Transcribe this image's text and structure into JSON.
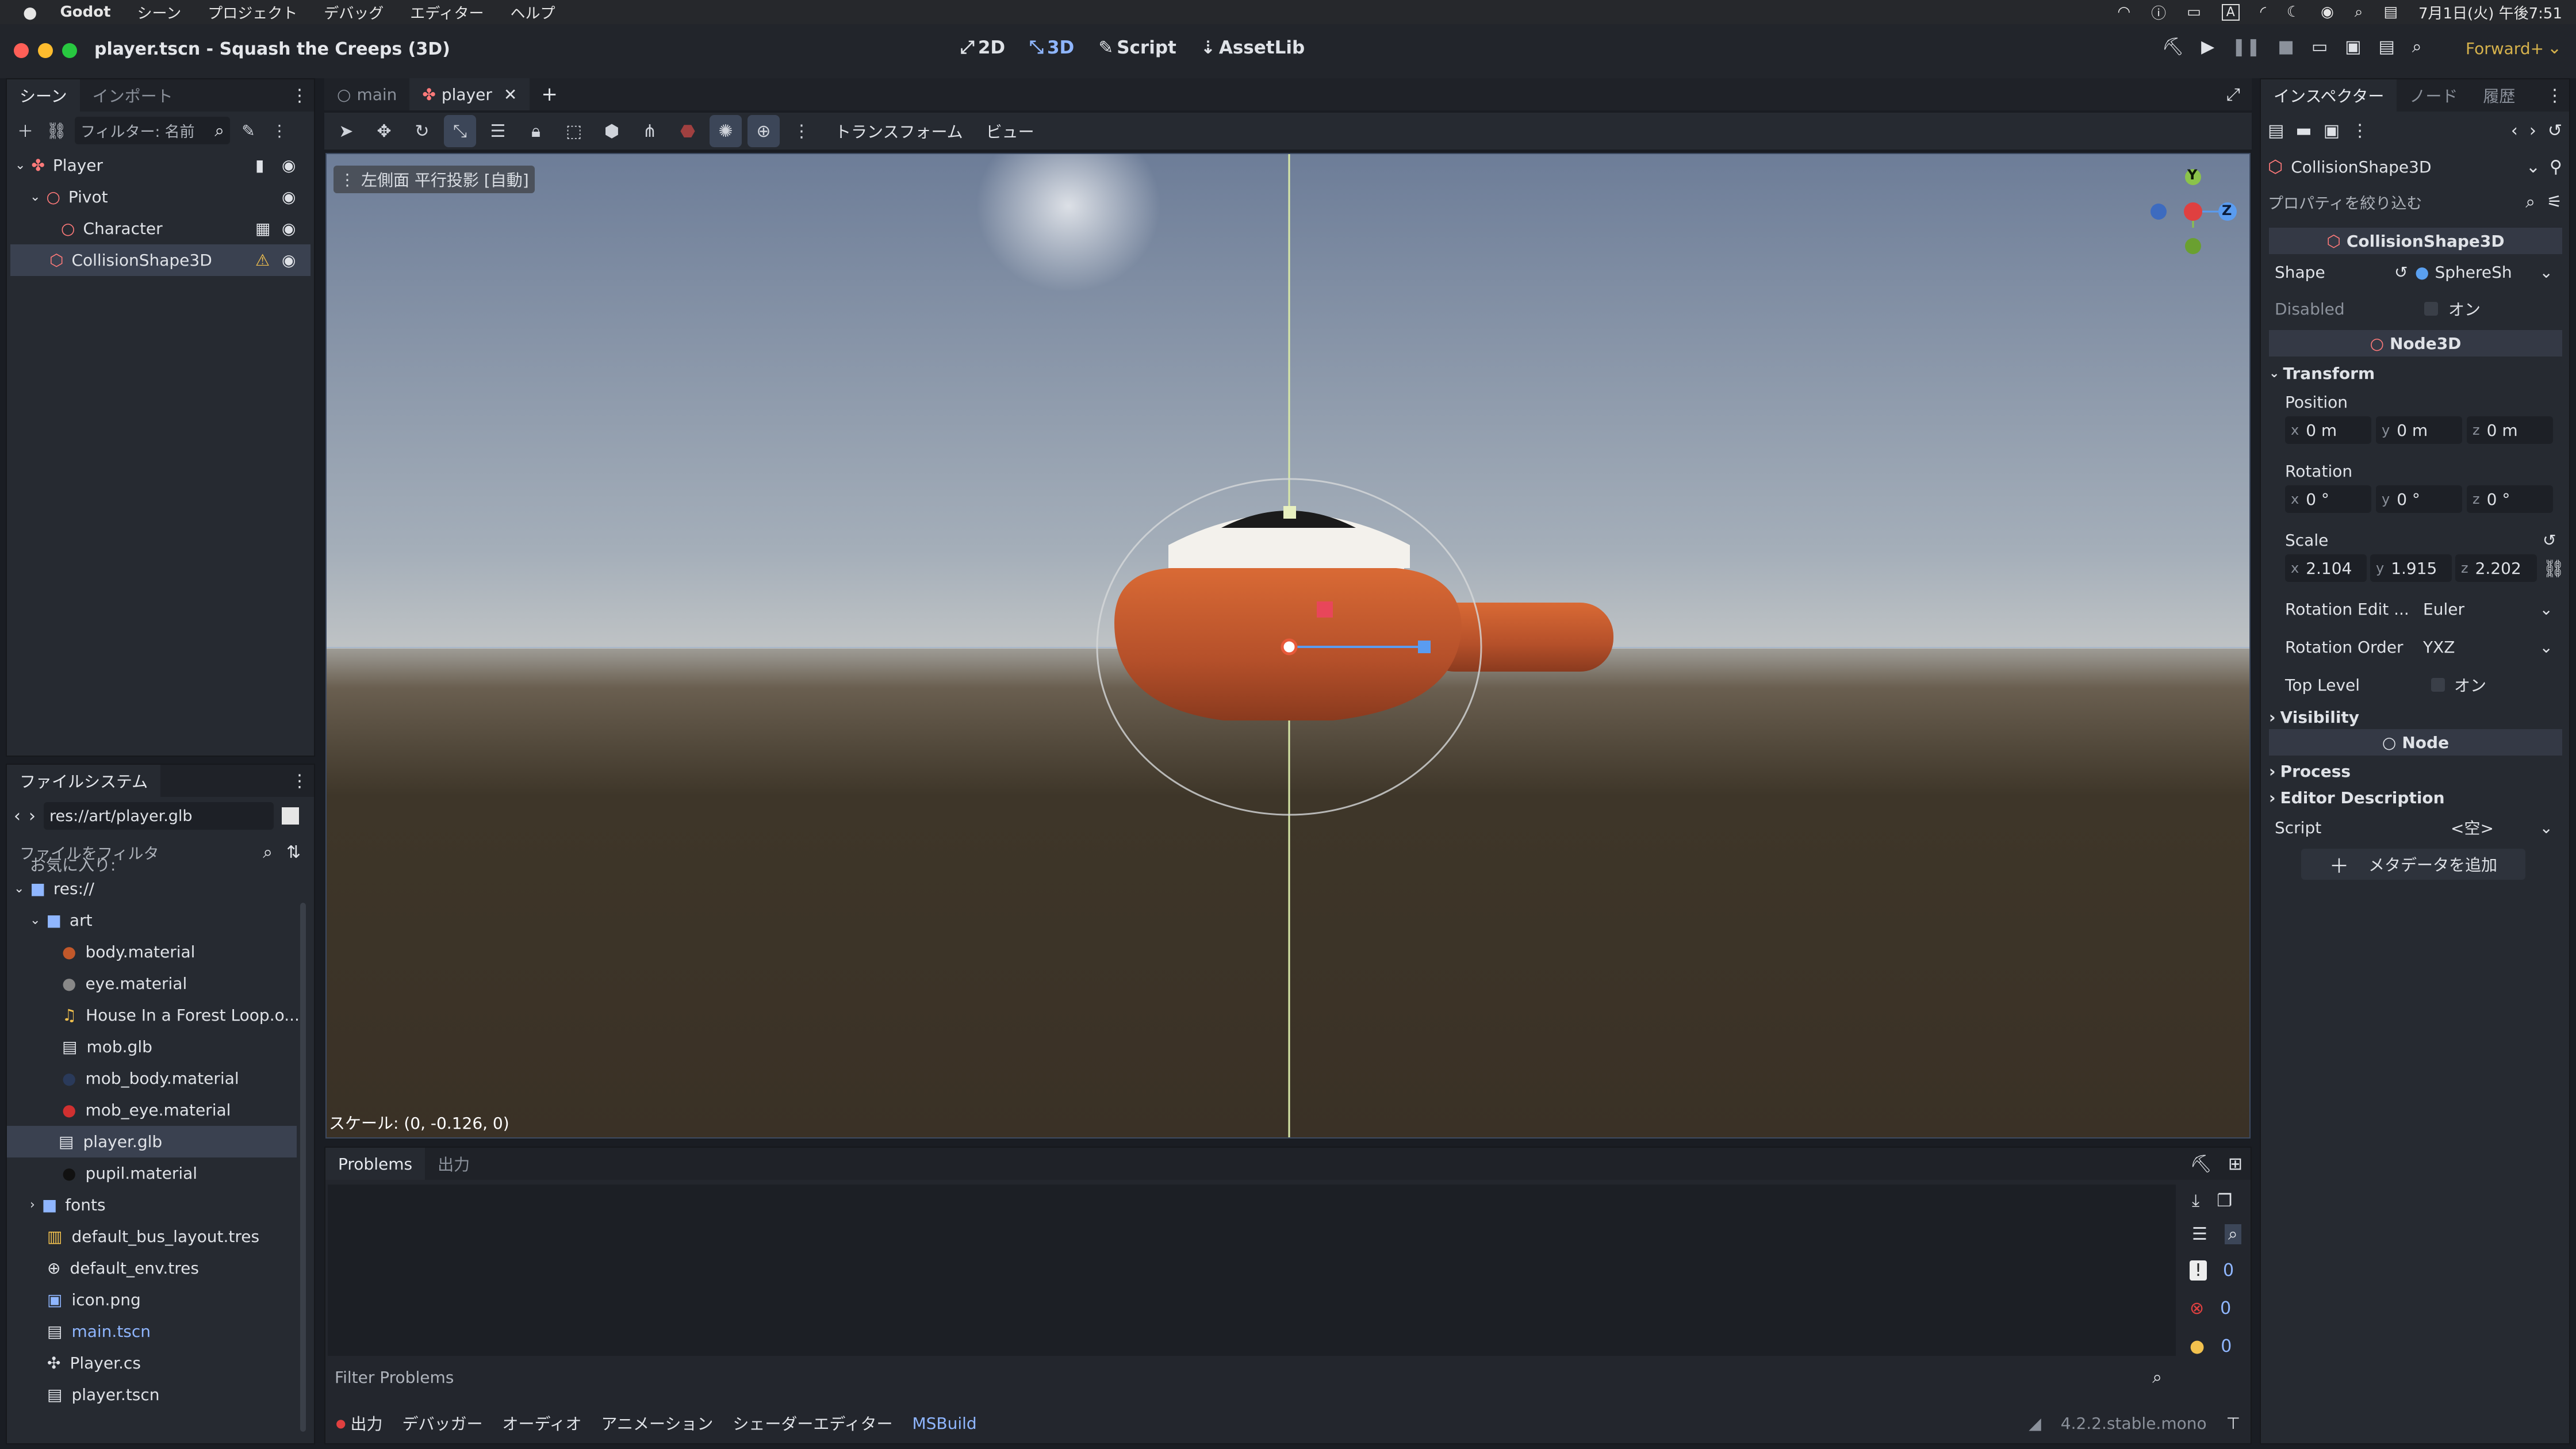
{
  "macbar": {
    "apple": "",
    "app": "Godot",
    "menus": [
      "シーン",
      "プロジェクト",
      "デバッグ",
      "エディター",
      "ヘルプ"
    ],
    "clock": "7月1日(火) 午後7:51",
    "input": "A"
  },
  "window": {
    "title": "player.tscn - Squash the Creeps (3D)",
    "modes": [
      "2D",
      "3D",
      "Script",
      "AssetLib"
    ],
    "renderer": "Forward+"
  },
  "scene_dock": {
    "tabs": [
      "シーン",
      "インポート"
    ],
    "filter_placeholder": "フィルター: 名前",
    "nodes": [
      {
        "name": "Player"
      },
      {
        "name": "Pivot"
      },
      {
        "name": "Character"
      },
      {
        "name": "CollisionShape3D"
      }
    ]
  },
  "fs_dock": {
    "tab": "ファイルシステム",
    "path": "res://art/player.glb",
    "filter_placeholder": "ファイルをフィルタ",
    "partial": "お気に入り:",
    "items": [
      "res://",
      "art",
      "body.material",
      "eye.material",
      "House In a Forest Loop.o...",
      "mob.glb",
      "mob_body.material",
      "mob_eye.material",
      "player.glb",
      "pupil.material",
      "fonts",
      "default_bus_layout.tres",
      "default_env.tres",
      "icon.png",
      "main.tscn",
      "Player.cs",
      "player.tscn"
    ]
  },
  "editor_tabs": {
    "tabs": [
      "main",
      "player"
    ],
    "add": "+"
  },
  "viewport_toolbar": {
    "transform": "トランスフォーム",
    "view": "ビュー"
  },
  "viewport": {
    "label": "左側面 平行投影 [自動]",
    "status": "スケール: (0, -0.126, 0)",
    "gizmo": {
      "y": "Y",
      "z": "Z"
    },
    "colors": {
      "sky_top": "#7b8aa3",
      "ground": "#3b3429",
      "body": "#c2582a"
    }
  },
  "bottom": {
    "tabs": [
      "Problems",
      "出力"
    ],
    "filter_placeholder": "Filter Problems",
    "counts": [
      "0",
      "0",
      "0"
    ],
    "bar": [
      "出力",
      "デバッガー",
      "オーディオ",
      "アニメーション",
      "シェーダーエディター",
      "MSBuild"
    ],
    "version": "4.2.2.stable.mono"
  },
  "inspector": {
    "tabs": [
      "インスペクター",
      "ノード",
      "履歴"
    ],
    "node": "CollisionShape3D",
    "filter_placeholder": "プロパティを絞り込む",
    "class1": "CollisionShape3D",
    "shape_label": "Shape",
    "shape_value": "SphereSh",
    "disabled_label": "Disabled",
    "on": "オン",
    "class2": "Node3D",
    "transform": "Transform",
    "position": "Position",
    "pos": [
      "0 m",
      "0 m",
      "0 m"
    ],
    "rotation": "Rotation",
    "rot": [
      "0 °",
      "0 °",
      "0 °"
    ],
    "scale": "Scale",
    "scl": [
      "2.104",
      "1.915",
      "2.202"
    ],
    "axes": [
      "x",
      "y",
      "z"
    ],
    "rot_edit_label": "Rotation Edit ...",
    "rot_edit_value": "Euler",
    "rot_order_label": "Rotation Order",
    "rot_order_value": "YXZ",
    "top_level": "Top Level",
    "visibility": "Visibility",
    "class3": "Node",
    "process": "Process",
    "editor_desc": "Editor Description",
    "script_label": "Script",
    "script_value": "<空>",
    "add_meta": "メタデータを追加"
  }
}
